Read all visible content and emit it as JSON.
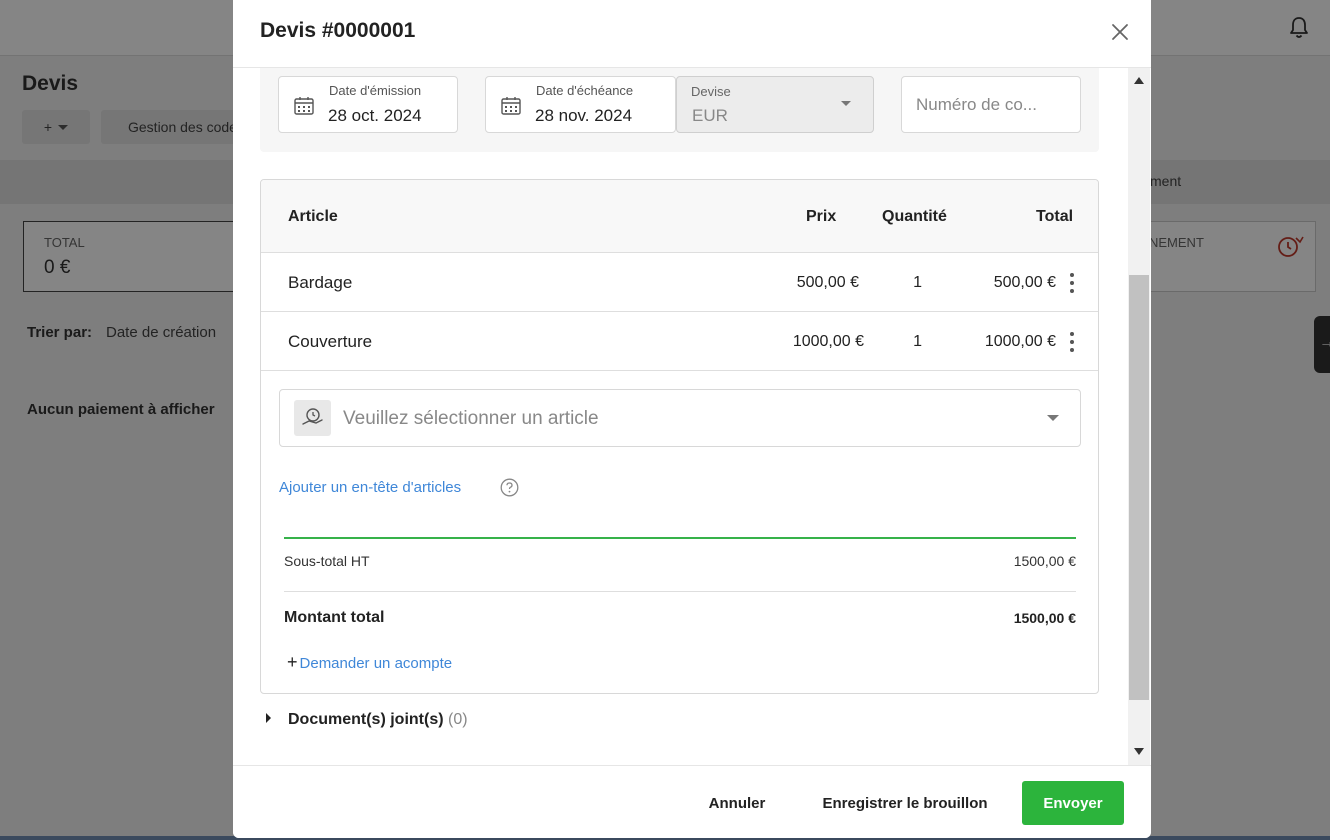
{
  "background": {
    "page_title": "Devis",
    "plus_button": "+",
    "codes_button": "Gestion des codes",
    "strip_text": "ment",
    "total_card": {
      "label": "TOTAL",
      "value": "0 €"
    },
    "right_card_label": "NEMENT",
    "sort_label": "Trier par:",
    "sort_value": "Date de création",
    "empty_message": "Aucun paiement à afficher",
    "side_tab_icon": "→"
  },
  "modal": {
    "title": "Devis #0000001",
    "dates": {
      "emission": {
        "label": "Date d'émission",
        "value": "28 oct. 2024"
      },
      "echeance": {
        "label": "Date d'échéance",
        "value": "28 nov. 2024"
      }
    },
    "devise": {
      "label": "Devise",
      "value": "EUR"
    },
    "numero": {
      "placeholder": "Numéro de co..."
    },
    "table": {
      "headers": {
        "article": "Article",
        "prix": "Prix",
        "quantite": "Quantité",
        "total": "Total"
      },
      "rows": [
        {
          "article": "Bardage",
          "prix": "500,00 €",
          "quantite": "1",
          "total": "500,00 €"
        },
        {
          "article": "Couverture",
          "prix": "1000,00 €",
          "quantite": "1",
          "total": "1000,00 €"
        }
      ]
    },
    "select_article_placeholder": "Veuillez sélectionner un article",
    "add_header_link": "Ajouter un en-tête d'articles",
    "subtotal": {
      "label": "Sous-total HT",
      "value": "1500,00 €"
    },
    "total": {
      "label": "Montant total",
      "value": "1500,00 €"
    },
    "acompte": {
      "plus": "+",
      "label": "Demander un acompte"
    },
    "documents": {
      "label": "Document(s) joint(s)",
      "count": "(0)"
    },
    "footer": {
      "cancel": "Annuler",
      "draft": "Enregistrer le brouillon",
      "send": "Envoyer"
    }
  },
  "colors": {
    "accent_green": "#2cb43c",
    "link_blue": "#3f87d8"
  }
}
